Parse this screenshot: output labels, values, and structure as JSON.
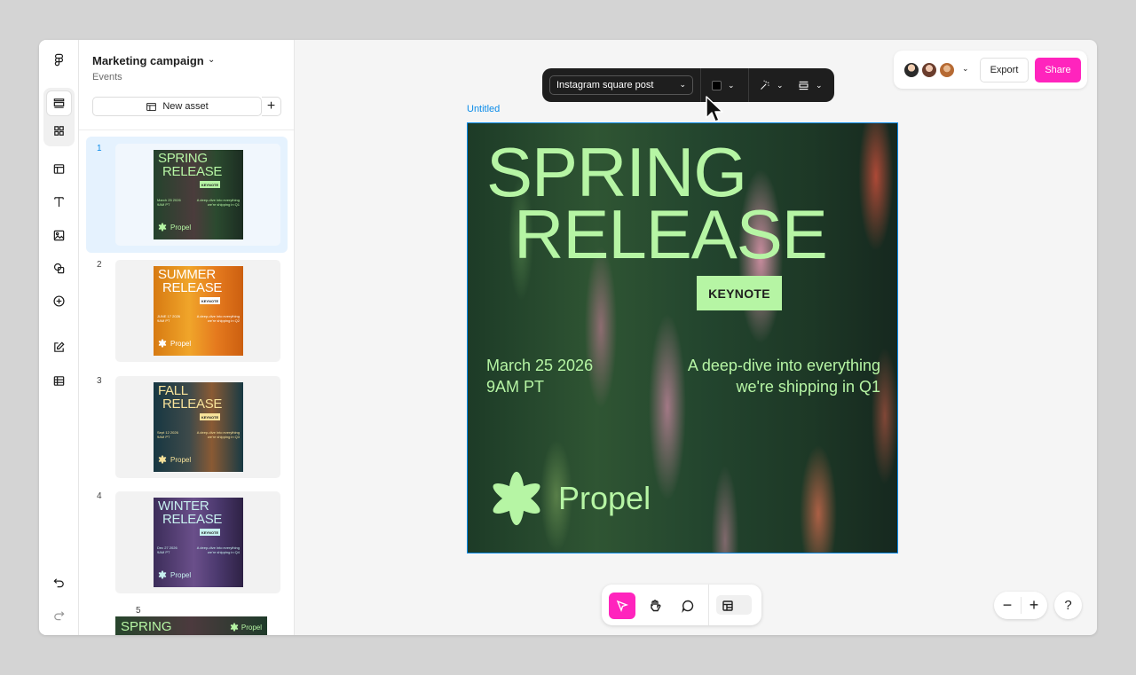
{
  "file": {
    "name": "Marketing campaign",
    "subtitle": "Events"
  },
  "panel": {
    "new_asset_label": "New asset"
  },
  "assets": [
    {
      "num": "1",
      "line1": "SPRING",
      "line2": "RELEASE",
      "badge": "KEYNOTE",
      "date": "March 25 2026\n9AM PT",
      "desc": "A deep-dive into everything\nwe're shipping in Q1",
      "logo": "Propel",
      "colors": {
        "bg": "#24432c",
        "accent": "#b6f5a4",
        "badge_bg": "#b6f5a4",
        "text": "#b6f5a4"
      }
    },
    {
      "num": "2",
      "line1": "SUMMER",
      "line2": "RELEASE",
      "badge": "KEYNOTE",
      "date": "JUNE 17 2026\n9AM PT",
      "desc": "A deep-dive into everything\nwe're shipping in Q2",
      "logo": "Propel",
      "colors": {
        "bg": "#e0891a",
        "accent": "#ffffff",
        "badge_bg": "#ffffff",
        "text": "#ffffff"
      }
    },
    {
      "num": "3",
      "line1": "FALL",
      "line2": "RELEASE",
      "badge": "KEYNOTE",
      "date": "Sept 12 2026\n9AM PT",
      "desc": "A deep-dive into everything\nwe're shipping in Q3",
      "logo": "Propel",
      "colors": {
        "bg": "#1d3c45",
        "accent": "#f7e29a",
        "badge_bg": "#f7e29a",
        "text": "#f7e29a"
      }
    },
    {
      "num": "4",
      "line1": "WINTER",
      "line2": "RELEASE",
      "badge": "KEYNOTE",
      "date": "Dec 27 2026\n9AM PT",
      "desc": "A deep-dive into everything\nwe're shipping in Q4",
      "logo": "Propel",
      "colors": {
        "bg": "#4b3a6a",
        "accent": "#c7f0ef",
        "badge_bg": "#c7f0ef",
        "text": "#c7f0ef"
      }
    }
  ],
  "asset5": {
    "num": "5",
    "title": "SPRING",
    "logo": "Propel"
  },
  "toolbar": {
    "preset": "Instagram square post",
    "fill_color": "#000000"
  },
  "canvas": {
    "frame_label": "Untitled",
    "poster": {
      "line1": "SPRING",
      "line2": "RELEASE",
      "badge": "KEYNOTE",
      "date": "March 25 2026\n9AM PT",
      "desc": "A deep-dive into everything\nwe're shipping in Q1",
      "logo": "Propel",
      "accent": "#b6f5a4"
    }
  },
  "header": {
    "export_label": "Export",
    "share_label": "Share",
    "share_color": "#ff24bd"
  },
  "bottom_tools": [
    "cursor-tool",
    "hand-tool",
    "comment-tool",
    "table-tool"
  ],
  "zoom": {
    "minus": "−",
    "plus": "+",
    "help": "?"
  }
}
